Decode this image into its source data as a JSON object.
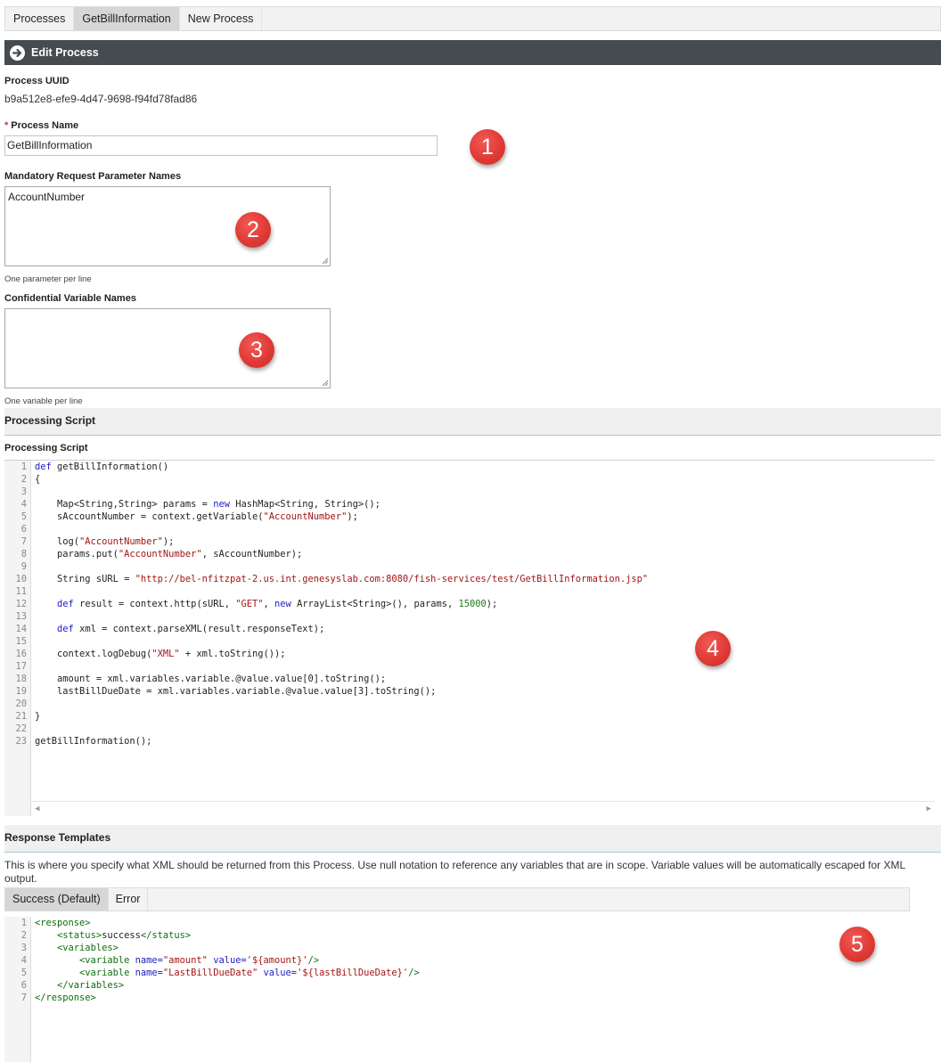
{
  "tabs": [
    "Processes",
    "GetBillInformation",
    "New Process"
  ],
  "panel": {
    "title": "Edit Process"
  },
  "form": {
    "uuid_label": "Process UUID",
    "uuid_value": "b9a512e8-efe9-4d47-9698-f94fd78fad86",
    "name_required_marker": "*",
    "name_label": "Process Name",
    "name_value": "GetBillInformation",
    "mandatory_label": "Mandatory Request Parameter Names",
    "mandatory_value": "AccountNumber",
    "mandatory_hint": "One parameter per line",
    "confidential_label": "Confidential Variable Names",
    "confidential_value": "",
    "confidential_hint": "One variable per line"
  },
  "processing": {
    "section_title": "Processing Script",
    "field_label": "Processing Script",
    "code": [
      [
        [
          "kw",
          "def"
        ],
        [
          "t",
          " getBillInformation()"
        ]
      ],
      [
        [
          "t",
          "{"
        ]
      ],
      [],
      [
        [
          "t",
          "    Map<String,String> params = "
        ],
        [
          "kw",
          "new"
        ],
        [
          "t",
          " HashMap<String, String>();"
        ]
      ],
      [
        [
          "t",
          "    sAccountNumber = context.getVariable("
        ],
        [
          "str",
          "\"AccountNumber\""
        ],
        [
          "t",
          ");"
        ]
      ],
      [],
      [
        [
          "t",
          "    log("
        ],
        [
          "str",
          "\"AccountNumber\""
        ],
        [
          "t",
          ");"
        ]
      ],
      [
        [
          "t",
          "    params.put("
        ],
        [
          "str",
          "\"AccountNumber\""
        ],
        [
          "t",
          ", sAccountNumber);"
        ]
      ],
      [],
      [
        [
          "t",
          "    String sURL = "
        ],
        [
          "str",
          "\"http://bel-nfitzpat-2.us.int.genesyslab.com:8080/fish-services/test/GetBillInformation.jsp\""
        ]
      ],
      [],
      [
        [
          "t",
          "    "
        ],
        [
          "kw",
          "def"
        ],
        [
          "t",
          " result = context.http(sURL, "
        ],
        [
          "str",
          "\"GET\""
        ],
        [
          "t",
          ", "
        ],
        [
          "kw",
          "new"
        ],
        [
          "t",
          " ArrayList<String>(), params, "
        ],
        [
          "num",
          "15000"
        ],
        [
          "t",
          ");"
        ]
      ],
      [],
      [
        [
          "t",
          "    "
        ],
        [
          "kw",
          "def"
        ],
        [
          "t",
          " xml = context.parseXML(result.responseText);"
        ]
      ],
      [],
      [
        [
          "t",
          "    context.logDebug("
        ],
        [
          "str",
          "\"XML\""
        ],
        [
          "t",
          " + xml.toString());"
        ]
      ],
      [],
      [
        [
          "t",
          "    amount = xml.variables.variable.@value.value[0].toString();"
        ]
      ],
      [
        [
          "t",
          "    lastBillDueDate = xml.variables.variable.@value.value[3].toString();"
        ]
      ],
      [],
      [
        [
          "t",
          "}"
        ]
      ],
      [],
      [
        [
          "t",
          "getBillInformation();"
        ]
      ]
    ]
  },
  "response": {
    "section_title": "Response Templates",
    "description": "This is where you specify what XML should be returned from this Process. Use null notation to reference any variables that are in scope. Variable values will be automatically escaped for XML output.",
    "tabs": [
      "Success (Default)",
      "Error"
    ],
    "code": [
      [
        [
          "tag",
          "<response>"
        ]
      ],
      [
        [
          "t",
          "    "
        ],
        [
          "tag",
          "<status>"
        ],
        [
          "t",
          "success"
        ],
        [
          "tag",
          "</status>"
        ]
      ],
      [
        [
          "t",
          "    "
        ],
        [
          "tag",
          "<variables>"
        ]
      ],
      [
        [
          "t",
          "        "
        ],
        [
          "tag",
          "<variable "
        ],
        [
          "attr",
          "name="
        ],
        [
          "str",
          "\"amount\""
        ],
        [
          "t",
          " "
        ],
        [
          "attr",
          "value="
        ],
        [
          "str",
          "'${amount}'"
        ],
        [
          "tag",
          "/>"
        ]
      ],
      [
        [
          "t",
          "        "
        ],
        [
          "tag",
          "<variable "
        ],
        [
          "attr",
          "name="
        ],
        [
          "str",
          "\"LastBillDueDate\""
        ],
        [
          "t",
          " "
        ],
        [
          "attr",
          "value="
        ],
        [
          "str",
          "'${lastBillDueDate}'"
        ],
        [
          "tag",
          "/>"
        ]
      ],
      [
        [
          "t",
          "    "
        ],
        [
          "tag",
          "</variables>"
        ]
      ],
      [
        [
          "tag",
          "</response>"
        ]
      ]
    ]
  },
  "callouts": [
    "1",
    "2",
    "3",
    "4",
    "5"
  ],
  "colors": {
    "header_bg": "#464b50",
    "badge": "#e03a36",
    "keyword": "#1c1cc4",
    "string": "#a31515"
  }
}
